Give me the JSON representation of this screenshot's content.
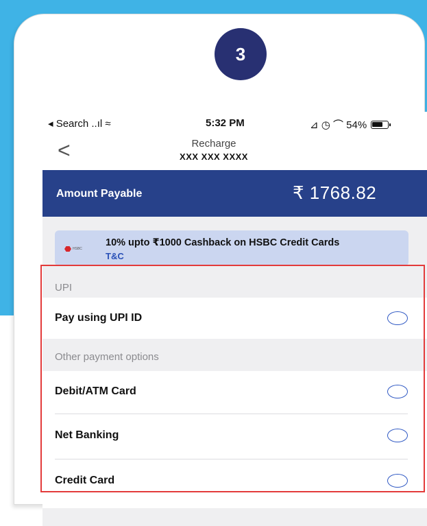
{
  "step_number": "3",
  "status_bar": {
    "left": "◂ Search ..ıl ≈",
    "time": "5:32 PM",
    "right": "⊿ ◷ ⌒ 54%",
    "icons": [
      "signal-icon",
      "wifi-icon",
      "location-icon",
      "alarm-icon",
      "headphones-icon",
      "battery-icon"
    ]
  },
  "nav": {
    "back_glyph": "<",
    "title": "Recharge",
    "subtitle": "XXX XXX XXXX"
  },
  "amount": {
    "label": "Amount Payable",
    "value": "₹ 1768.82"
  },
  "offer": {
    "logo_text": "HSBC",
    "text": "10% upto ₹1000 Cashback on HSBC Credit Cards",
    "link": "T&C"
  },
  "sections": {
    "upi_header": "UPI",
    "upi_option": "Pay using UPI ID",
    "other_header": "Other payment options",
    "options": [
      "Debit/ATM Card",
      "Net Banking",
      "Credit Card"
    ]
  },
  "colors": {
    "background_blue": "#3fb3e6",
    "badge": "#283072",
    "amount_bar": "#27418a",
    "highlight": "#e33a3a",
    "radio": "#2d57c3"
  }
}
